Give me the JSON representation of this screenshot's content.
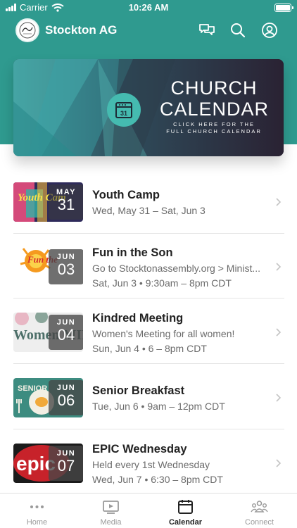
{
  "status_bar": {
    "carrier": "Carrier",
    "time": "10:26 AM"
  },
  "app": {
    "title": "Stockton AG"
  },
  "banner": {
    "title_line1": "CHURCH",
    "title_line2": "CALENDAR",
    "subtitle_line1": "CLICK HERE FOR THE",
    "subtitle_line2": "FULL CHURCH CALENDAR",
    "icon_day": "31"
  },
  "events": [
    {
      "title": "Youth Camp",
      "line1": "Wed, May 31 – Sat, Jun 3",
      "line2": "",
      "month": "MAY",
      "day": "31"
    },
    {
      "title": "Fun in the Son",
      "line1": "Go to Stocktonassembly.org > Minist...",
      "line2": "Sat, Jun 3 • 9:30am – 8pm CDT",
      "month": "JUN",
      "day": "03"
    },
    {
      "title": "Kindred Meeting",
      "line1": "Women's Meeting for all women!",
      "line2": "Sun, Jun 4 • 6 – 8pm CDT",
      "month": "JUN",
      "day": "04"
    },
    {
      "title": "Senior Breakfast",
      "line1": "Tue, Jun 6 • 9am – 12pm CDT",
      "line2": "",
      "month": "JUN",
      "day": "06"
    },
    {
      "title": "EPIC Wednesday",
      "line1": "Held every 1st Wednesday",
      "line2": "Wed, Jun 7 • 6:30 – 8pm CDT",
      "month": "JUN",
      "day": "07"
    }
  ],
  "thumb_art": {
    "youth": "Youth Cam",
    "fun": "Fun the",
    "women": "Women MINISTRY",
    "senior": "SENIOR",
    "epic": "epic"
  },
  "tabs": [
    {
      "label": "Home",
      "icon": "dots-icon"
    },
    {
      "label": "Media",
      "icon": "media-icon"
    },
    {
      "label": "Calendar",
      "icon": "calendar-icon",
      "active": true
    },
    {
      "label": "Connect",
      "icon": "people-icon"
    }
  ],
  "colors": {
    "header": "#2f9a8f",
    "accent": "#45bbb0",
    "tab_active": "#222222",
    "tab_inactive": "#9a9a9a"
  }
}
